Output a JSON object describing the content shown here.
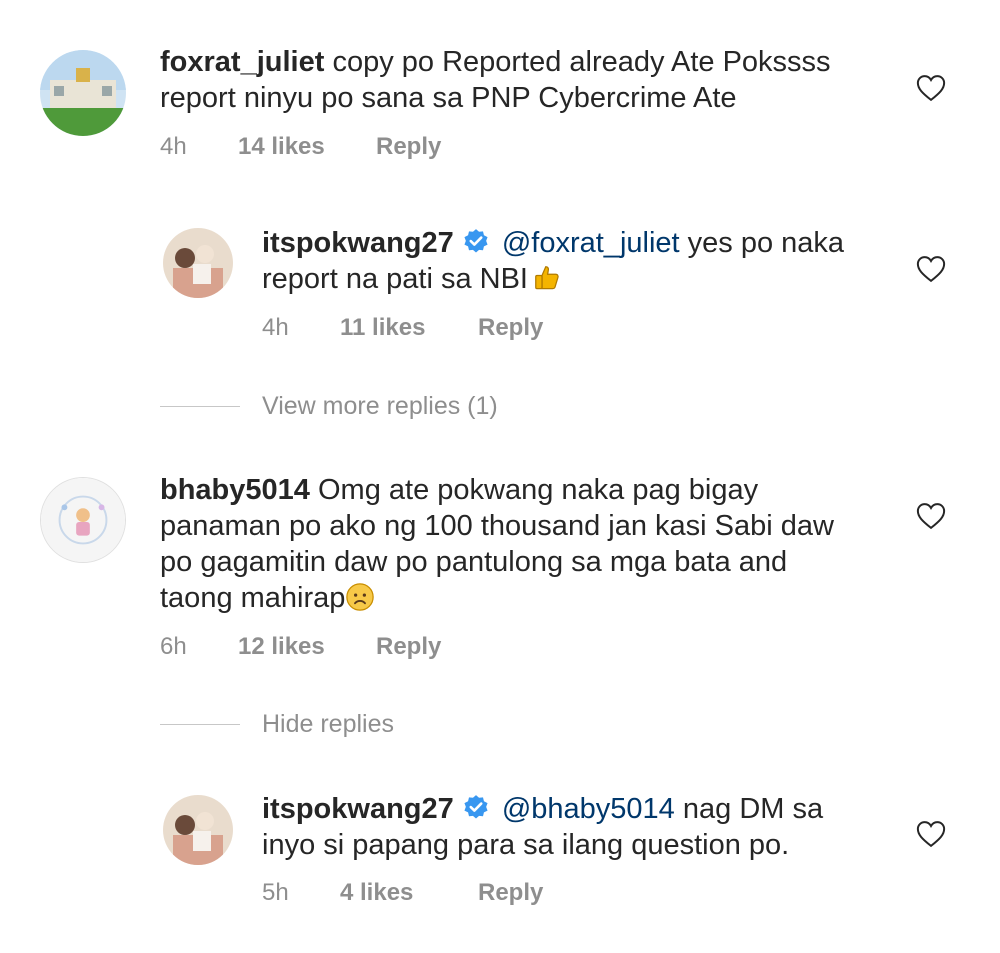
{
  "comments": [
    {
      "username": "foxrat_juliet",
      "text_line1": "copy po Reported already Ate Pokssss",
      "text_line2": "report ninyu po sana sa PNP Cybercrime Ate",
      "time": "4h",
      "likes": "14 likes",
      "reply": "Reply"
    },
    {
      "username": "itspokwang27",
      "mention": "@foxrat_juliet",
      "text_line1": "yes po naka",
      "text_line2": "report na pati sa NBI",
      "emoji": "thumbs-up",
      "time": "4h",
      "likes": "11 likes",
      "reply": "Reply"
    },
    {
      "username": "bhaby5014",
      "text_line1": "Omg ate pokwang naka pag bigay",
      "text_line2": "panaman po ako ng 100 thousand jan kasi Sabi daw",
      "text_line3": "po gagamitin daw po pantulong sa mga bata and",
      "text_line4": "taong mahirap",
      "emoji": "worried-face",
      "time": "6h",
      "likes": "12 likes",
      "reply": "Reply"
    },
    {
      "username": "itspokwang27",
      "mention": "@bhaby5014",
      "text_line1": "nag DM sa",
      "text_line2": "inyo si papang para sa ilang question po.",
      "time": "5h",
      "likes": "4 likes",
      "reply": "Reply"
    }
  ],
  "view_more_replies": "View more replies (1)",
  "hide_replies": "Hide replies",
  "colors": {
    "text": "#262626",
    "meta": "#8e8e8e",
    "mention": "#00376b",
    "verified": "#3897f0"
  }
}
